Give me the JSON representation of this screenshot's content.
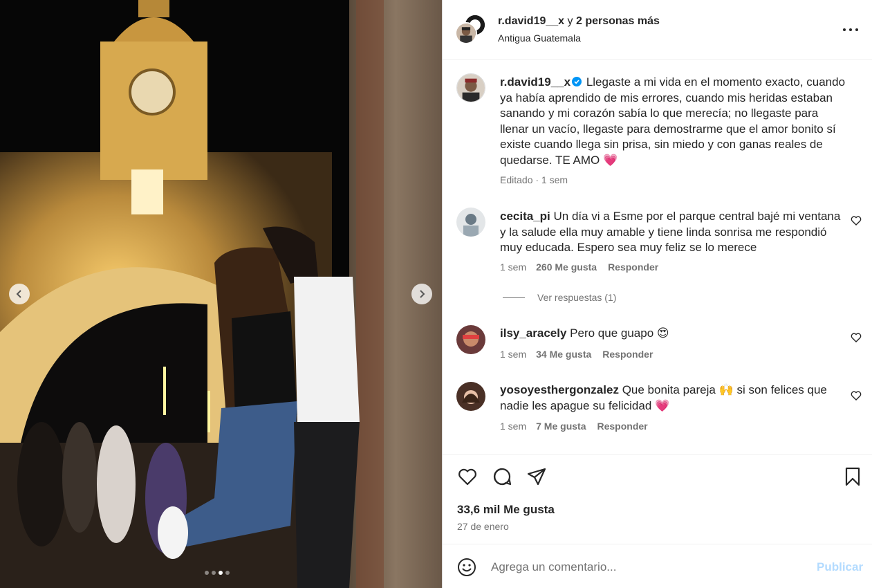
{
  "post": {
    "author": "r.david19__x",
    "coauthors_joiner": " y ",
    "coauthors": "2 personas más",
    "location": "Antigua Guatemala"
  },
  "media": {
    "slides": 4,
    "active_slide": 3,
    "description_icon": "photo"
  },
  "caption": {
    "username": "r.david19__x",
    "text": "Llegaste a mi vida en el momento exacto, cuando ya había aprendido de mis errores, cuando mis heridas estaban sanando y mi corazón sabía lo que merecía; no llegaste para llenar un vacío, llegaste para demostrarme que el amor bonito sí existe cuando llega sin prisa, sin miedo y con ganas reales de quedarse. TE AMO",
    "emoji": "💗",
    "meta": "Editado · 1 sem"
  },
  "comments": [
    {
      "username": "cecita_pi",
      "text": "Un día vi a Esme por el parque central bajé mi ventana y la salude ella muy amable y tiene linda sonrisa me respondió muy educada. Espero sea muy feliz se lo merece",
      "emoji": "",
      "time": "1 sem",
      "likes": "260 Me gusta",
      "reply": "Responder"
    },
    {
      "username": "ilsy_aracely",
      "text": "Pero que guapo",
      "emoji": "😍",
      "time": "1 sem",
      "likes": "34 Me gusta",
      "reply": "Responder"
    },
    {
      "username": "yosoyesthergonzalez",
      "text": "Que bonita pareja 🙌 si son felices que nadie les apague su felicidad",
      "emoji": "💗",
      "time": "1 sem",
      "likes": "7 Me gusta",
      "reply": "Responder"
    }
  ],
  "view_replies": "Ver respuestas (1)",
  "actions": {
    "likes": "33,6 mil Me gusta",
    "date": "27 de enero"
  },
  "composer": {
    "placeholder": "Agrega un comentario...",
    "publish": "Publicar"
  },
  "colors": {
    "link_blue": "#0095f6",
    "publish_disabled": "#b3dbff",
    "heart_pink": "#ff3b8b",
    "muted": "#737373"
  }
}
